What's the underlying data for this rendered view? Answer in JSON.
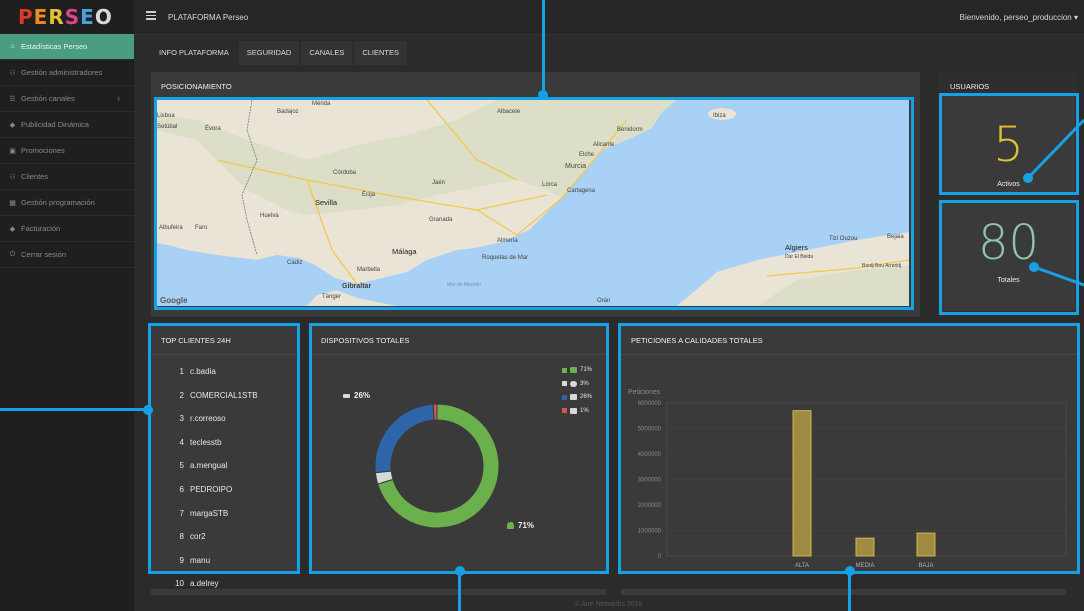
{
  "app": {
    "logo": "PERSEO",
    "title": "PLATAFORMA Perseo",
    "welcome": "Bienvenido, perseo_produccion ▾"
  },
  "sidebar": {
    "items": [
      {
        "label": "Estadísticas Perseo",
        "icon": "home-icon"
      },
      {
        "label": "Gestión administradores",
        "icon": "users-icon"
      },
      {
        "label": "Gestión canales",
        "icon": "list-icon"
      },
      {
        "label": "Publicidad Dinámica",
        "icon": "tag-icon"
      },
      {
        "label": "Promociones",
        "icon": "gift-icon"
      },
      {
        "label": "Clientes",
        "icon": "users-icon"
      },
      {
        "label": "Gestión programación",
        "icon": "calendar-icon"
      },
      {
        "label": "Facturación",
        "icon": "tag-icon"
      },
      {
        "label": "Cerrar sesión",
        "icon": "power-icon"
      }
    ]
  },
  "tabs": [
    "INFO PLATAFORMA",
    "SEGURIDAD",
    "CANALES",
    "CLIENTES"
  ],
  "positioning": {
    "title": "POSICIONAMIENTO",
    "map_labels": [
      "Badajoz",
      "Mérida",
      "Albacete",
      "Ibiza",
      "Benidorm",
      "Alicante",
      "Elche",
      "Murcia",
      "Lorca",
      "Cartagena",
      "Córdoba",
      "Jaén",
      "Écija",
      "Sevilla",
      "Huelva",
      "Granada",
      "Évora",
      "Setúbal",
      "Lisboa",
      "Albufeira",
      "Faro",
      "Málaga",
      "Almería",
      "Roquetas de Mar",
      "Marbella",
      "Cádiz",
      "Gibraltar",
      "Tánger",
      "Orán",
      "Algiers",
      "Tizi Ouzou",
      "Bejaia",
      "Dar El Beida",
      "Bordj Bou Arreridj",
      "Google",
      "Mar de Alborán"
    ]
  },
  "users": {
    "title": "USUARIOS",
    "active_value": "5",
    "active_label": "Activos",
    "total_value": "80",
    "total_label": "Totales"
  },
  "top_clients": {
    "title": "TOP CLIENTES 24H",
    "items": [
      {
        "rank": "1",
        "name": "c.badia"
      },
      {
        "rank": "2",
        "name": "COMERCIAL1STB"
      },
      {
        "rank": "3",
        "name": "r.correoso"
      },
      {
        "rank": "4",
        "name": "teclesstb"
      },
      {
        "rank": "5",
        "name": "a.mengual"
      },
      {
        "rank": "6",
        "name": "PEDROIPO"
      },
      {
        "rank": "7",
        "name": "margaSTB"
      },
      {
        "rank": "8",
        "name": "cor2"
      },
      {
        "rank": "9",
        "name": "manu"
      },
      {
        "rank": "10",
        "name": "a.delrey"
      }
    ]
  },
  "devices": {
    "title": "DISPOSITIVOS TOTALES",
    "left_label": "26%",
    "right_label": "71%",
    "chart_data": {
      "type": "pie",
      "categories": [
        "android-icon",
        "apple-icon",
        "desktop-icon",
        "tv-icon"
      ],
      "values": [
        71,
        3,
        26,
        1
      ],
      "labels": [
        "71%",
        "3%",
        "26%",
        "1%"
      ],
      "colors": [
        "#6ab04c",
        "#d8d8d8",
        "#2e64a8",
        "#d9534f"
      ]
    }
  },
  "requests": {
    "title": "PETICIONES A CALIDADES TOTALES",
    "chart_data": {
      "type": "bar",
      "categories": [
        "ALTA",
        "MEDIA",
        "BAJA"
      ],
      "values": [
        5700000,
        700000,
        900000
      ],
      "ylabel": "Peticiones",
      "ylim": [
        0,
        6000000
      ],
      "yticks": [
        "0",
        "1000000",
        "2000000",
        "3000000",
        "4000000",
        "5000000",
        "6000000"
      ],
      "color": "#a08b43"
    }
  },
  "footer": {
    "text": "© Aire Networks 2016"
  },
  "colors": {
    "accent": "#17a1e5",
    "active_nav": "#4a9d7f",
    "active_value": "#e0c232",
    "total_value": "#8fc5a8"
  }
}
